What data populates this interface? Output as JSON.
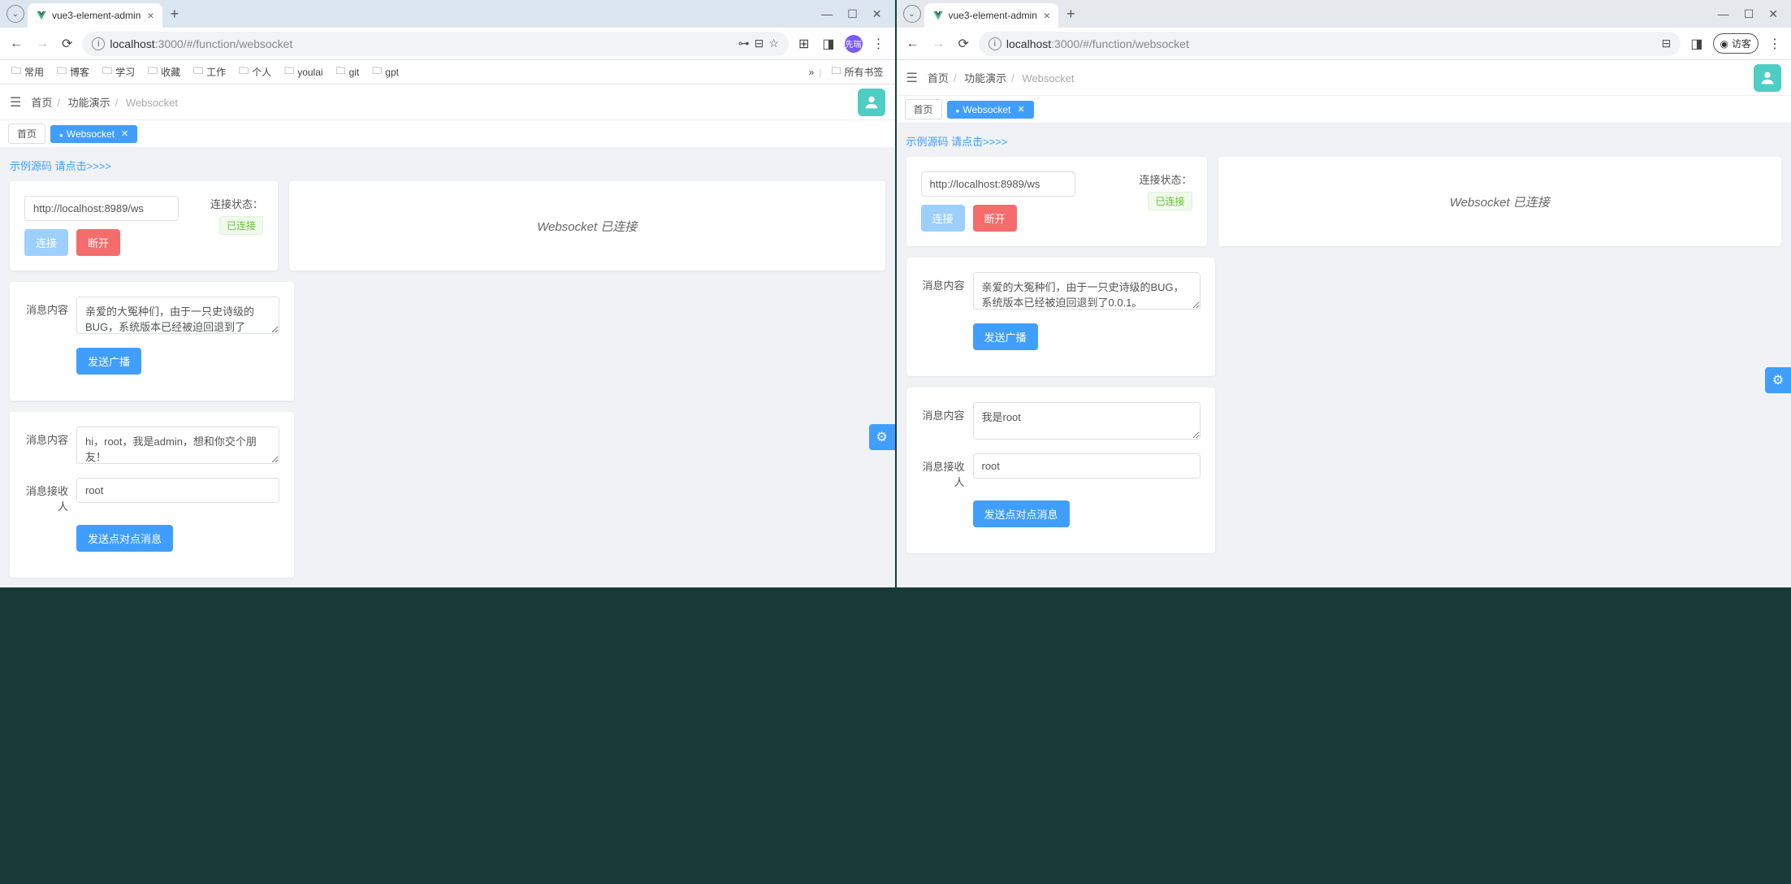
{
  "left": {
    "browserTab": {
      "title": "vue3-element-admin"
    },
    "url": {
      "host": "localhost",
      "port": ":3000",
      "path": "/#/function/websocket"
    },
    "profileBadge": "先瑞",
    "bookmarks": [
      "常用",
      "博客",
      "学习",
      "收藏",
      "工作",
      "个人",
      "youlai",
      "git",
      "gpt"
    ],
    "bookmarksAll": "所有书签",
    "breadcrumbs": [
      "首页",
      "功能演示",
      "Websocket"
    ],
    "viewTabs": {
      "home": "首页",
      "ws": "Websocket"
    },
    "sourceLink": "示例源码 请点击>>>>",
    "conn": {
      "wsUrl": "http://localhost:8989/ws",
      "statusLabel": "连接状态：",
      "statusBadge": "已连接",
      "connectBtn": "连接",
      "disconnectBtn": "断开"
    },
    "statusCard": "Websocket 已连接",
    "broadcast": {
      "label": "消息内容",
      "value": "亲爱的大冤种们，由于一只史诗级的BUG，系统版本已经被迫回退到了",
      "sendBtn": "发送广播"
    },
    "p2p": {
      "msgLabel": "消息内容",
      "msgValue": "hi，root，我是admin，想和你交个朋友！",
      "recvLabel": "消息接收人",
      "recvValue": "root",
      "sendBtn": "发送点对点消息"
    }
  },
  "right": {
    "browserTab": {
      "title": "vue3-element-admin"
    },
    "url": {
      "host": "localhost",
      "port": ":3000",
      "path": "/#/function/websocket"
    },
    "guestLabel": "访客",
    "breadcrumbs": [
      "首页",
      "功能演示",
      "Websocket"
    ],
    "viewTabs": {
      "home": "首页",
      "ws": "Websocket"
    },
    "sourceLink": "示例源码 请点击>>>>",
    "conn": {
      "wsUrl": "http://localhost:8989/ws",
      "statusLabel": "连接状态：",
      "statusBadge": "已连接",
      "connectBtn": "连接",
      "disconnectBtn": "断开"
    },
    "statusCard": "Websocket 已连接",
    "broadcast": {
      "label": "消息内容",
      "value": "亲爱的大冤种们，由于一只史诗级的BUG，系统版本已经被迫回退到了0.0.1。",
      "sendBtn": "发送广播"
    },
    "p2p": {
      "msgLabel": "消息内容",
      "msgValue": "我是root",
      "recvLabel": "消息接收人",
      "recvValue": "root",
      "sendBtn": "发送点对点消息"
    }
  }
}
